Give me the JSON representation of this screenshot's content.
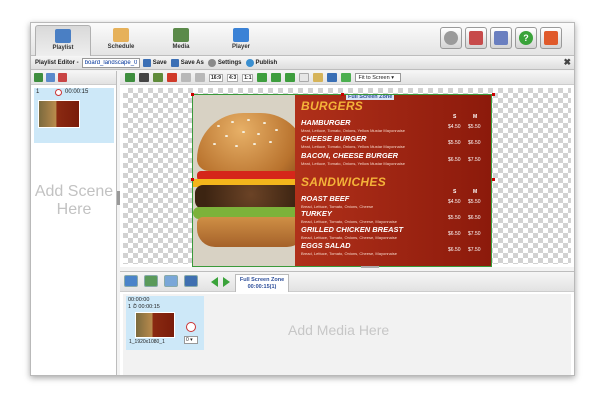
{
  "nav": {
    "tabs": [
      {
        "label": "Playlist",
        "icon": "playlist-icon",
        "color": "#4a7fc4"
      },
      {
        "label": "Schedule",
        "icon": "calendar-icon",
        "color": "#e6b15a"
      },
      {
        "label": "Media",
        "icon": "film-icon",
        "color": "#5b8a4a"
      },
      {
        "label": "Player",
        "icon": "monitor-icon",
        "color": "#3b82d6"
      }
    ],
    "right_buttons": [
      {
        "icon": "gear-icon",
        "color": "#9a9a9a"
      },
      {
        "icon": "layers-icon",
        "color": "#c74b4b"
      },
      {
        "icon": "screens-icon",
        "color": "#6a7fc0"
      },
      {
        "icon": "help-icon",
        "color": "#3aa33a"
      },
      {
        "icon": "logout-icon",
        "color": "#e05a2b"
      }
    ]
  },
  "editor": {
    "title": "Playlist Editor -",
    "name_value": "board_landscape_01",
    "save_label": "Save",
    "save_as_label": "Save As",
    "settings_label": "Settings",
    "publish_label": "Publish"
  },
  "scenes": {
    "items": [
      {
        "number": "1",
        "duration": "00:00:15"
      }
    ],
    "add_text": "Add Scene Here"
  },
  "canvas_toolbar": {
    "ratio_buttons": [
      "16:9",
      "4:3",
      "1:1"
    ],
    "fit_select": "Fit to Screen"
  },
  "zone": {
    "label": "Full Screen Zone"
  },
  "menu": {
    "burgers_title": "BURGERS",
    "sandwiches_title": "SANDWICHES",
    "col_s": "S",
    "col_m": "M",
    "burgers": [
      {
        "name": "HAMBURGER",
        "desc": "Meat, Lettuce, Tomato, Onions, Yellow Mustar Mayonnaise",
        "s": "$4.50",
        "m": "$5.50"
      },
      {
        "name": "CHEESE BURGER",
        "desc": "Meat, Lettuce, Tomato, Onions, Yellow Mustar Mayonnaise",
        "s": "$5.50",
        "m": "$6.50"
      },
      {
        "name": "BACON, CHEESE BURGER",
        "desc": "Meat, Lettuce, Tomato, Onions, Yellow Mustar Mayonnaise",
        "s": "$6.50",
        "m": "$7.50"
      }
    ],
    "sandwiches": [
      {
        "name": "ROAST BEEF",
        "desc": "Bread, Lettuce, Tomato, Onions, Cheese",
        "s": "$4.50",
        "m": "$5.50"
      },
      {
        "name": "TURKEY",
        "desc": "Bread, Lettuce, Tomato, Onions, Cheese, Mayonnaise",
        "s": "$5.50",
        "m": "$6.50"
      },
      {
        "name": "GRILLED CHICKEN BREAST",
        "desc": "Bread, Lettuce, Tomato, Onions, Cheese, Mayonnaise",
        "s": "$6.50",
        "m": "$7.50"
      },
      {
        "name": "EGGS SALAD",
        "desc": "Bread, Lettuce, Tomato, Onions, Cheese, Mayonnaise",
        "s": "$6.50",
        "m": "$7.50"
      }
    ]
  },
  "timeline": {
    "zone_tab_label": "Full Screen Zone",
    "zone_tab_duration": "00:00:15(1)",
    "media_items": [
      {
        "time": "00:00:00",
        "number": "1",
        "duration": "00:00:15",
        "filename": "1_1920x1080_1",
        "select_value": "0"
      }
    ],
    "add_text": "Add  Media  Here"
  }
}
